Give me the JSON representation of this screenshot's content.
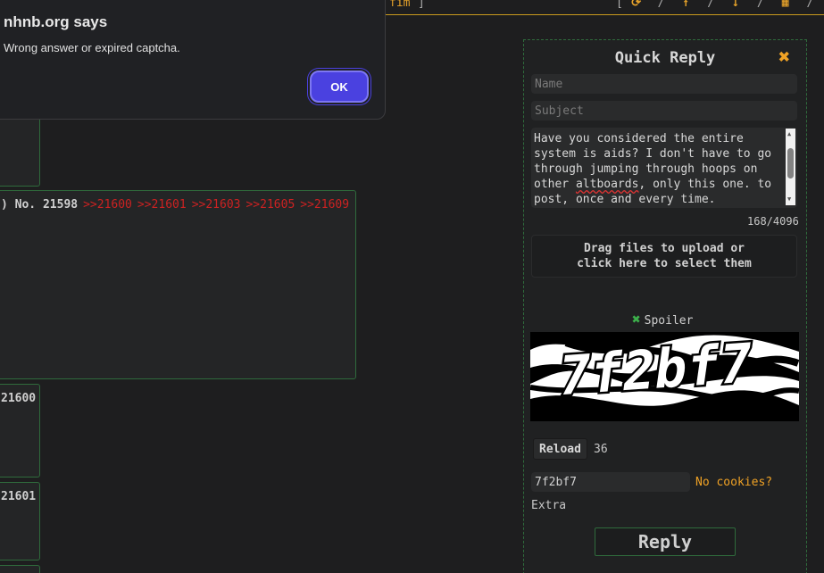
{
  "topbar": {
    "title_fragment": "fim",
    "title_bracket": "]",
    "nav_open": "[",
    "nav_close": "]",
    "nav_separator": "/",
    "nav_icons": [
      "refresh-icon",
      "arrow-up-icon",
      "arrow-down-icon",
      "grid-icon",
      "list-icon"
    ],
    "accent_color": "#e6a22a"
  },
  "dialog": {
    "site": "nhnb.org says",
    "message": "Wrong answer or expired captcha.",
    "ok_label": "OK"
  },
  "posts": [
    {
      "number_prefix": ") No. 21598",
      "replies": [
        ">>21600",
        ">>21601",
        ">>21603",
        ">>21605",
        ">>21609"
      ]
    },
    {
      "number": "21600"
    },
    {
      "number": "21601"
    }
  ],
  "quick_reply": {
    "title": "Quick Reply",
    "name_placeholder": "Name",
    "subject_placeholder": "Subject",
    "message_lines": [
      "Have you considered the entire",
      "system is aids? I don't have to go",
      "through jumping through hoops on",
      "other ",
      "altboards",
      ", only this one. to",
      "post, once and every time."
    ],
    "char_counter": "168/4096",
    "dropzone_line1": "Drag files to upload or",
    "dropzone_line2": "click here to select them",
    "spoiler_label": "Spoiler",
    "captcha_text": "7f2bf7",
    "reload_label": "Reload",
    "timer": "36",
    "captcha_answer": "7f2bf7",
    "no_cookies_label": "No cookies?",
    "extra_label": "Extra",
    "reply_label": "Reply"
  }
}
